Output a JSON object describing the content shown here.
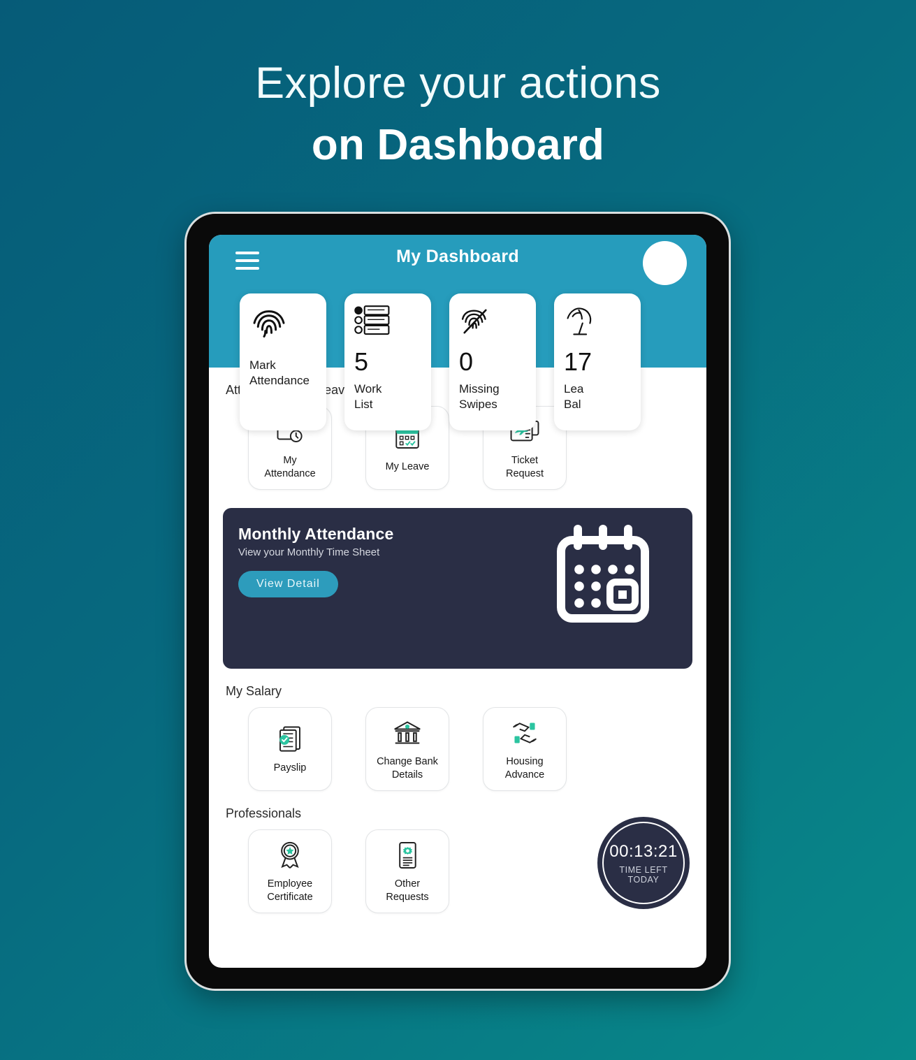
{
  "headline": {
    "line1": "Explore your actions",
    "line2": "on Dashboard"
  },
  "colors": {
    "background_start": "#065b78",
    "background_end": "#088a8a",
    "header_teal": "#269cbc",
    "banner_navy": "#2a2e45",
    "accent_green": "#2bc4a0",
    "button_teal": "#2d9cbc"
  },
  "app_header": {
    "menu_icon": "hamburger-menu-icon",
    "title": "My Dashboard",
    "avatar_icon": "user-avatar-icon"
  },
  "stat_cards": [
    {
      "icon": "fingerprint-icon",
      "value": "",
      "label": "Mark\nAttendance",
      "label_line1": "Mark",
      "label_line2": "Attendance"
    },
    {
      "icon": "checklist-icon",
      "value": "5",
      "label": "Work List",
      "label_line1": "Work",
      "label_line2": "List"
    },
    {
      "icon": "fingerprint-slash-icon",
      "value": "0",
      "label": "Missing Swipes",
      "label_line1": "Missing",
      "label_line2": "Swipes"
    },
    {
      "icon": "beach-umbrella-icon",
      "value": "17",
      "label": "Leave Balance",
      "label_line1": "Lea",
      "label_line2": "Bal"
    }
  ],
  "sections": [
    {
      "title": "Attendance and Leave",
      "tiles": [
        {
          "icon": "calendar-clock-icon",
          "line1": "My",
          "line2": "Attendance"
        },
        {
          "icon": "calendar-check-icon",
          "line1": "My Leave",
          "line2": ""
        },
        {
          "icon": "flight-ticket-icon",
          "line1": "Ticket",
          "line2": "Request"
        }
      ]
    },
    {
      "title": "My Salary",
      "tiles": [
        {
          "icon": "payslip-check-icon",
          "line1": "Payslip",
          "line2": ""
        },
        {
          "icon": "bank-building-icon",
          "line1": "Change Bank",
          "line2": "Details"
        },
        {
          "icon": "money-hands-icon",
          "line1": "Housing",
          "line2": "Advance"
        }
      ]
    },
    {
      "title": "Professionals",
      "tiles": [
        {
          "icon": "award-ribbon-icon",
          "line1": "Employee",
          "line2": "Certificate"
        },
        {
          "icon": "document-gear-icon",
          "line1": "Other",
          "line2": "Requests"
        }
      ]
    }
  ],
  "banner": {
    "title": "Monthly Attendance",
    "subtitle": "View your Monthly Time Sheet",
    "button_label": "View Detail",
    "art_icon": "calendar-grid-icon"
  },
  "timer": {
    "value": "00:13:21",
    "caption_line1": "TIME LEFT",
    "caption_line2": "TODAY"
  }
}
